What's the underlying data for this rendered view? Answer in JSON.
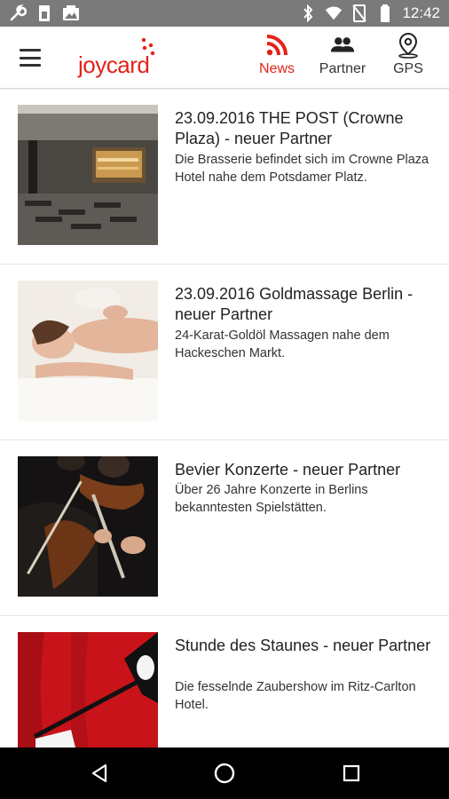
{
  "status_bar": {
    "time": "12:42",
    "icons_left": [
      "wrench-icon",
      "sim-card-icon",
      "image-icon"
    ],
    "icons_right": [
      "bluetooth-icon",
      "wifi-icon",
      "no-sim-icon",
      "battery-icon"
    ]
  },
  "app_bar": {
    "menu_icon": "hamburger-icon",
    "logo_text": "joycard",
    "tabs": [
      {
        "label": "News",
        "icon": "rss-icon",
        "active": true
      },
      {
        "label": "Partner",
        "icon": "people-icon",
        "active": false
      },
      {
        "label": "GPS",
        "icon": "location-pin-icon",
        "active": false
      }
    ],
    "accent_color": "#e2231a"
  },
  "news": [
    {
      "title": "23.09.2016 THE POST (Crowne Plaza) - neuer Partner",
      "description": "Die Brasserie befindet sich im Crowne Plaza Hotel nahe dem Potsdamer Platz.",
      "image": "restaurant-interior-photo"
    },
    {
      "title": "23.09.2016 Goldmassage Berlin - neuer Partner",
      "description": "24-Karat-Goldöl Massagen nahe dem Hackeschen Markt.",
      "image": "massage-photo"
    },
    {
      "title": "Bevier Konzerte - neuer Partner",
      "description": "Über 26 Jahre Konzerte in Berlins bekanntesten Spielstätten.",
      "image": "violinists-photo"
    },
    {
      "title": "Stunde des Staunes - neuer Partner",
      "description": "Die fesselnde Zaubershow im Ritz-Carlton Hotel.",
      "image": "magician-wand-photo"
    }
  ],
  "nav_bar": {
    "buttons": [
      "back-icon",
      "home-icon",
      "recents-icon"
    ]
  }
}
